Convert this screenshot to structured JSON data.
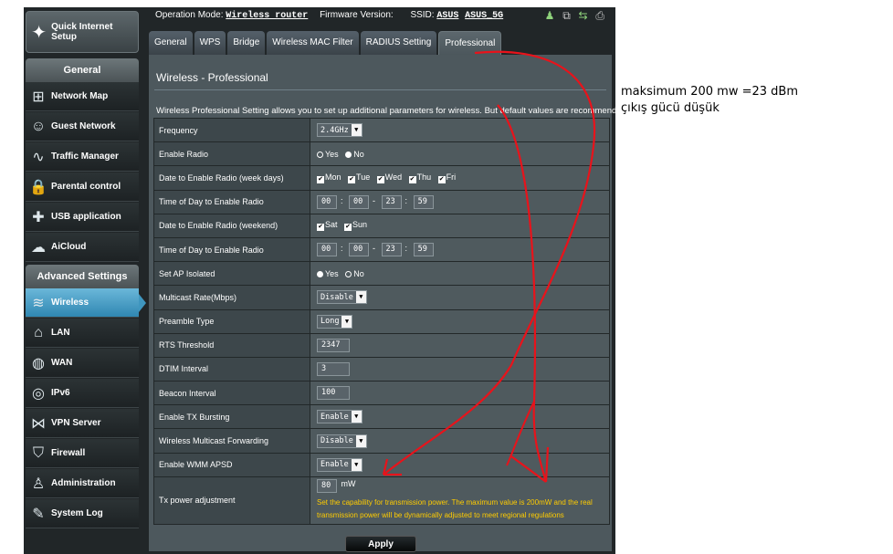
{
  "sidebar": {
    "quick_setup": "Quick Internet Setup",
    "general_header": "General",
    "general_items": [
      {
        "label": "Network Map",
        "icon": "network-map-icon"
      },
      {
        "label": "Guest Network",
        "icon": "guest-network-icon"
      },
      {
        "label": "Traffic Manager",
        "icon": "traffic-manager-icon"
      },
      {
        "label": "Parental control",
        "icon": "lock-icon"
      },
      {
        "label": "USB application",
        "icon": "puzzle-icon"
      },
      {
        "label": "AiCloud",
        "icon": "cloud-icon"
      }
    ],
    "advanced_header": "Advanced Settings",
    "advanced_items": [
      {
        "label": "Wireless",
        "icon": "wifi-icon",
        "active": true
      },
      {
        "label": "LAN",
        "icon": "home-icon"
      },
      {
        "label": "WAN",
        "icon": "globe-icon"
      },
      {
        "label": "IPv6",
        "icon": "ipv6-icon"
      },
      {
        "label": "VPN Server",
        "icon": "vpn-icon"
      },
      {
        "label": "Firewall",
        "icon": "shield-icon"
      },
      {
        "label": "Administration",
        "icon": "user-icon"
      },
      {
        "label": "System Log",
        "icon": "log-icon"
      }
    ]
  },
  "topbar": {
    "op_mode_label": "Operation Mode:",
    "op_mode_value": "Wireless router",
    "firmware_label": "Firmware Version:",
    "ssid_label": "SSID:",
    "ssid_1": "ASUS",
    "ssid_2": "ASUS_5G"
  },
  "tabs": [
    "General",
    "WPS",
    "Bridge",
    "Wireless MAC Filter",
    "RADIUS Setting",
    "Professional"
  ],
  "panel": {
    "title": "Wireless - Professional",
    "description": "Wireless Professional Setting allows you to set up additional parameters for wireless. But default values are recommended.",
    "rows": {
      "frequency": {
        "label": "Frequency",
        "value": "2.4GHz"
      },
      "enable_radio": {
        "label": "Enable Radio",
        "yes": "Yes",
        "no": "No"
      },
      "date_weekdays": {
        "label": "Date to Enable Radio (week days)",
        "days": [
          "Mon",
          "Tue",
          "Wed",
          "Thu",
          "Fri"
        ]
      },
      "time_weekdays": {
        "label": "Time of Day to Enable Radio",
        "h1": "00",
        "m1": "00",
        "h2": "23",
        "m2": "59"
      },
      "date_weekend": {
        "label": "Date to Enable Radio (weekend)",
        "days": [
          "Sat",
          "Sun"
        ]
      },
      "time_weekend": {
        "label": "Time of Day to Enable Radio",
        "h1": "00",
        "m1": "00",
        "h2": "23",
        "m2": "59"
      },
      "ap_isolated": {
        "label": "Set AP Isolated",
        "yes": "Yes",
        "no": "No"
      },
      "multicast_rate": {
        "label": "Multicast Rate(Mbps)",
        "value": "Disable"
      },
      "preamble": {
        "label": "Preamble Type",
        "value": "Long"
      },
      "rts": {
        "label": "RTS Threshold",
        "value": "2347"
      },
      "dtim": {
        "label": "DTIM Interval",
        "value": "3"
      },
      "beacon": {
        "label": "Beacon Interval",
        "value": "100"
      },
      "tx_bursting": {
        "label": "Enable TX Bursting",
        "value": "Enable"
      },
      "multicast_fwd": {
        "label": "Wireless Multicast Forwarding",
        "value": "Disable"
      },
      "wmm_apsd": {
        "label": "Enable WMM APSD",
        "value": "Enable"
      },
      "tx_power": {
        "label": "Tx power adjustment",
        "value": "80",
        "unit": "mW",
        "note": "Set the capability for transmission power. The maximum value is 200mW and the real transmission power will be dynamically adjusted to meet regional regulations"
      }
    },
    "apply": "Apply"
  },
  "annotation": {
    "line1": "maksimum 200 mw =23 dBm",
    "line2": "çıkış gücü düşük",
    "color": "#e8131b"
  }
}
